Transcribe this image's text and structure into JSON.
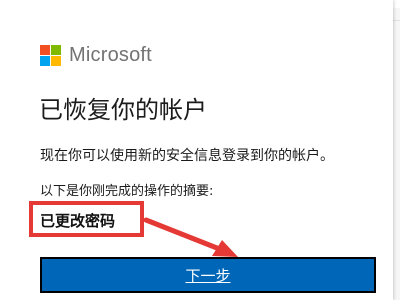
{
  "brand": {
    "name": "Microsoft",
    "logo_colors": [
      "#f25022",
      "#7fba00",
      "#00a4ef",
      "#ffb900"
    ]
  },
  "dialog": {
    "title": "已恢复你的帐户",
    "description": "现在你可以使用新的安全信息登录到你的帐户。",
    "summary_label": "以下是你刚完成的操作的摘要:",
    "summary_items": [
      "已更改密码"
    ],
    "next_button_label": "下一步"
  },
  "colors": {
    "accent": "#0067b8",
    "annotation": "#e53935"
  },
  "icons": {
    "logo": "microsoft-logo-icon",
    "annotation_arrow": "red-arrow-icon"
  }
}
